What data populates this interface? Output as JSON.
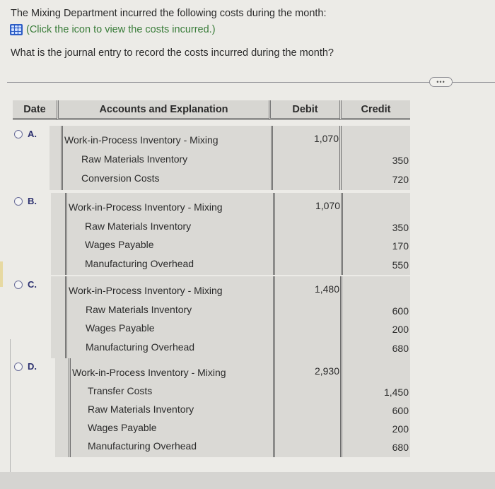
{
  "question": {
    "line1": "The Mixing Department incurred the following costs during the month:",
    "link_icon": "table-grid-icon",
    "link_text": "(Click the icon to view the costs incurred.)",
    "line3": "What is the journal entry to record the costs incurred during the month?"
  },
  "more_button": {
    "icon": "ellipsis-icon",
    "label": "•••"
  },
  "table_header": {
    "date": "Date",
    "accounts": "Accounts and Explanation",
    "debit": "Debit",
    "credit": "Credit"
  },
  "options": [
    {
      "letter": "A.",
      "debit_account": "Work-in-Process Inventory - Mixing",
      "debit_amount": "1,070",
      "credits": [
        {
          "account": "Raw Materials Inventory",
          "amount": "350"
        },
        {
          "account": "Conversion Costs",
          "amount": "720"
        }
      ]
    },
    {
      "letter": "B.",
      "debit_account": "Work-in-Process Inventory - Mixing",
      "debit_amount": "1,070",
      "credits": [
        {
          "account": "Raw Materials Inventory",
          "amount": "350"
        },
        {
          "account": "Wages Payable",
          "amount": "170"
        },
        {
          "account": "Manufacturing Overhead",
          "amount": "550"
        }
      ]
    },
    {
      "letter": "C.",
      "debit_account": "Work-in-Process Inventory - Mixing",
      "debit_amount": "1,480",
      "credits": [
        {
          "account": "Raw Materials Inventory",
          "amount": "600"
        },
        {
          "account": "Wages Payable",
          "amount": "200"
        },
        {
          "account": "Manufacturing Overhead",
          "amount": "680"
        }
      ]
    },
    {
      "letter": "D.",
      "debit_account": "Work-in-Process Inventory - Mixing",
      "debit_amount": "2,930",
      "credits": [
        {
          "account": "Transfer Costs",
          "amount": "1,450"
        },
        {
          "account": "Raw Materials Inventory",
          "amount": "600"
        },
        {
          "account": "Wages Payable",
          "amount": "200"
        },
        {
          "account": "Manufacturing Overhead",
          "amount": "680"
        }
      ]
    }
  ],
  "colors": {
    "link_green": "#3a7d3a",
    "icon_blue": "#2c5cc5",
    "option_letter": "#2b2f6e"
  }
}
